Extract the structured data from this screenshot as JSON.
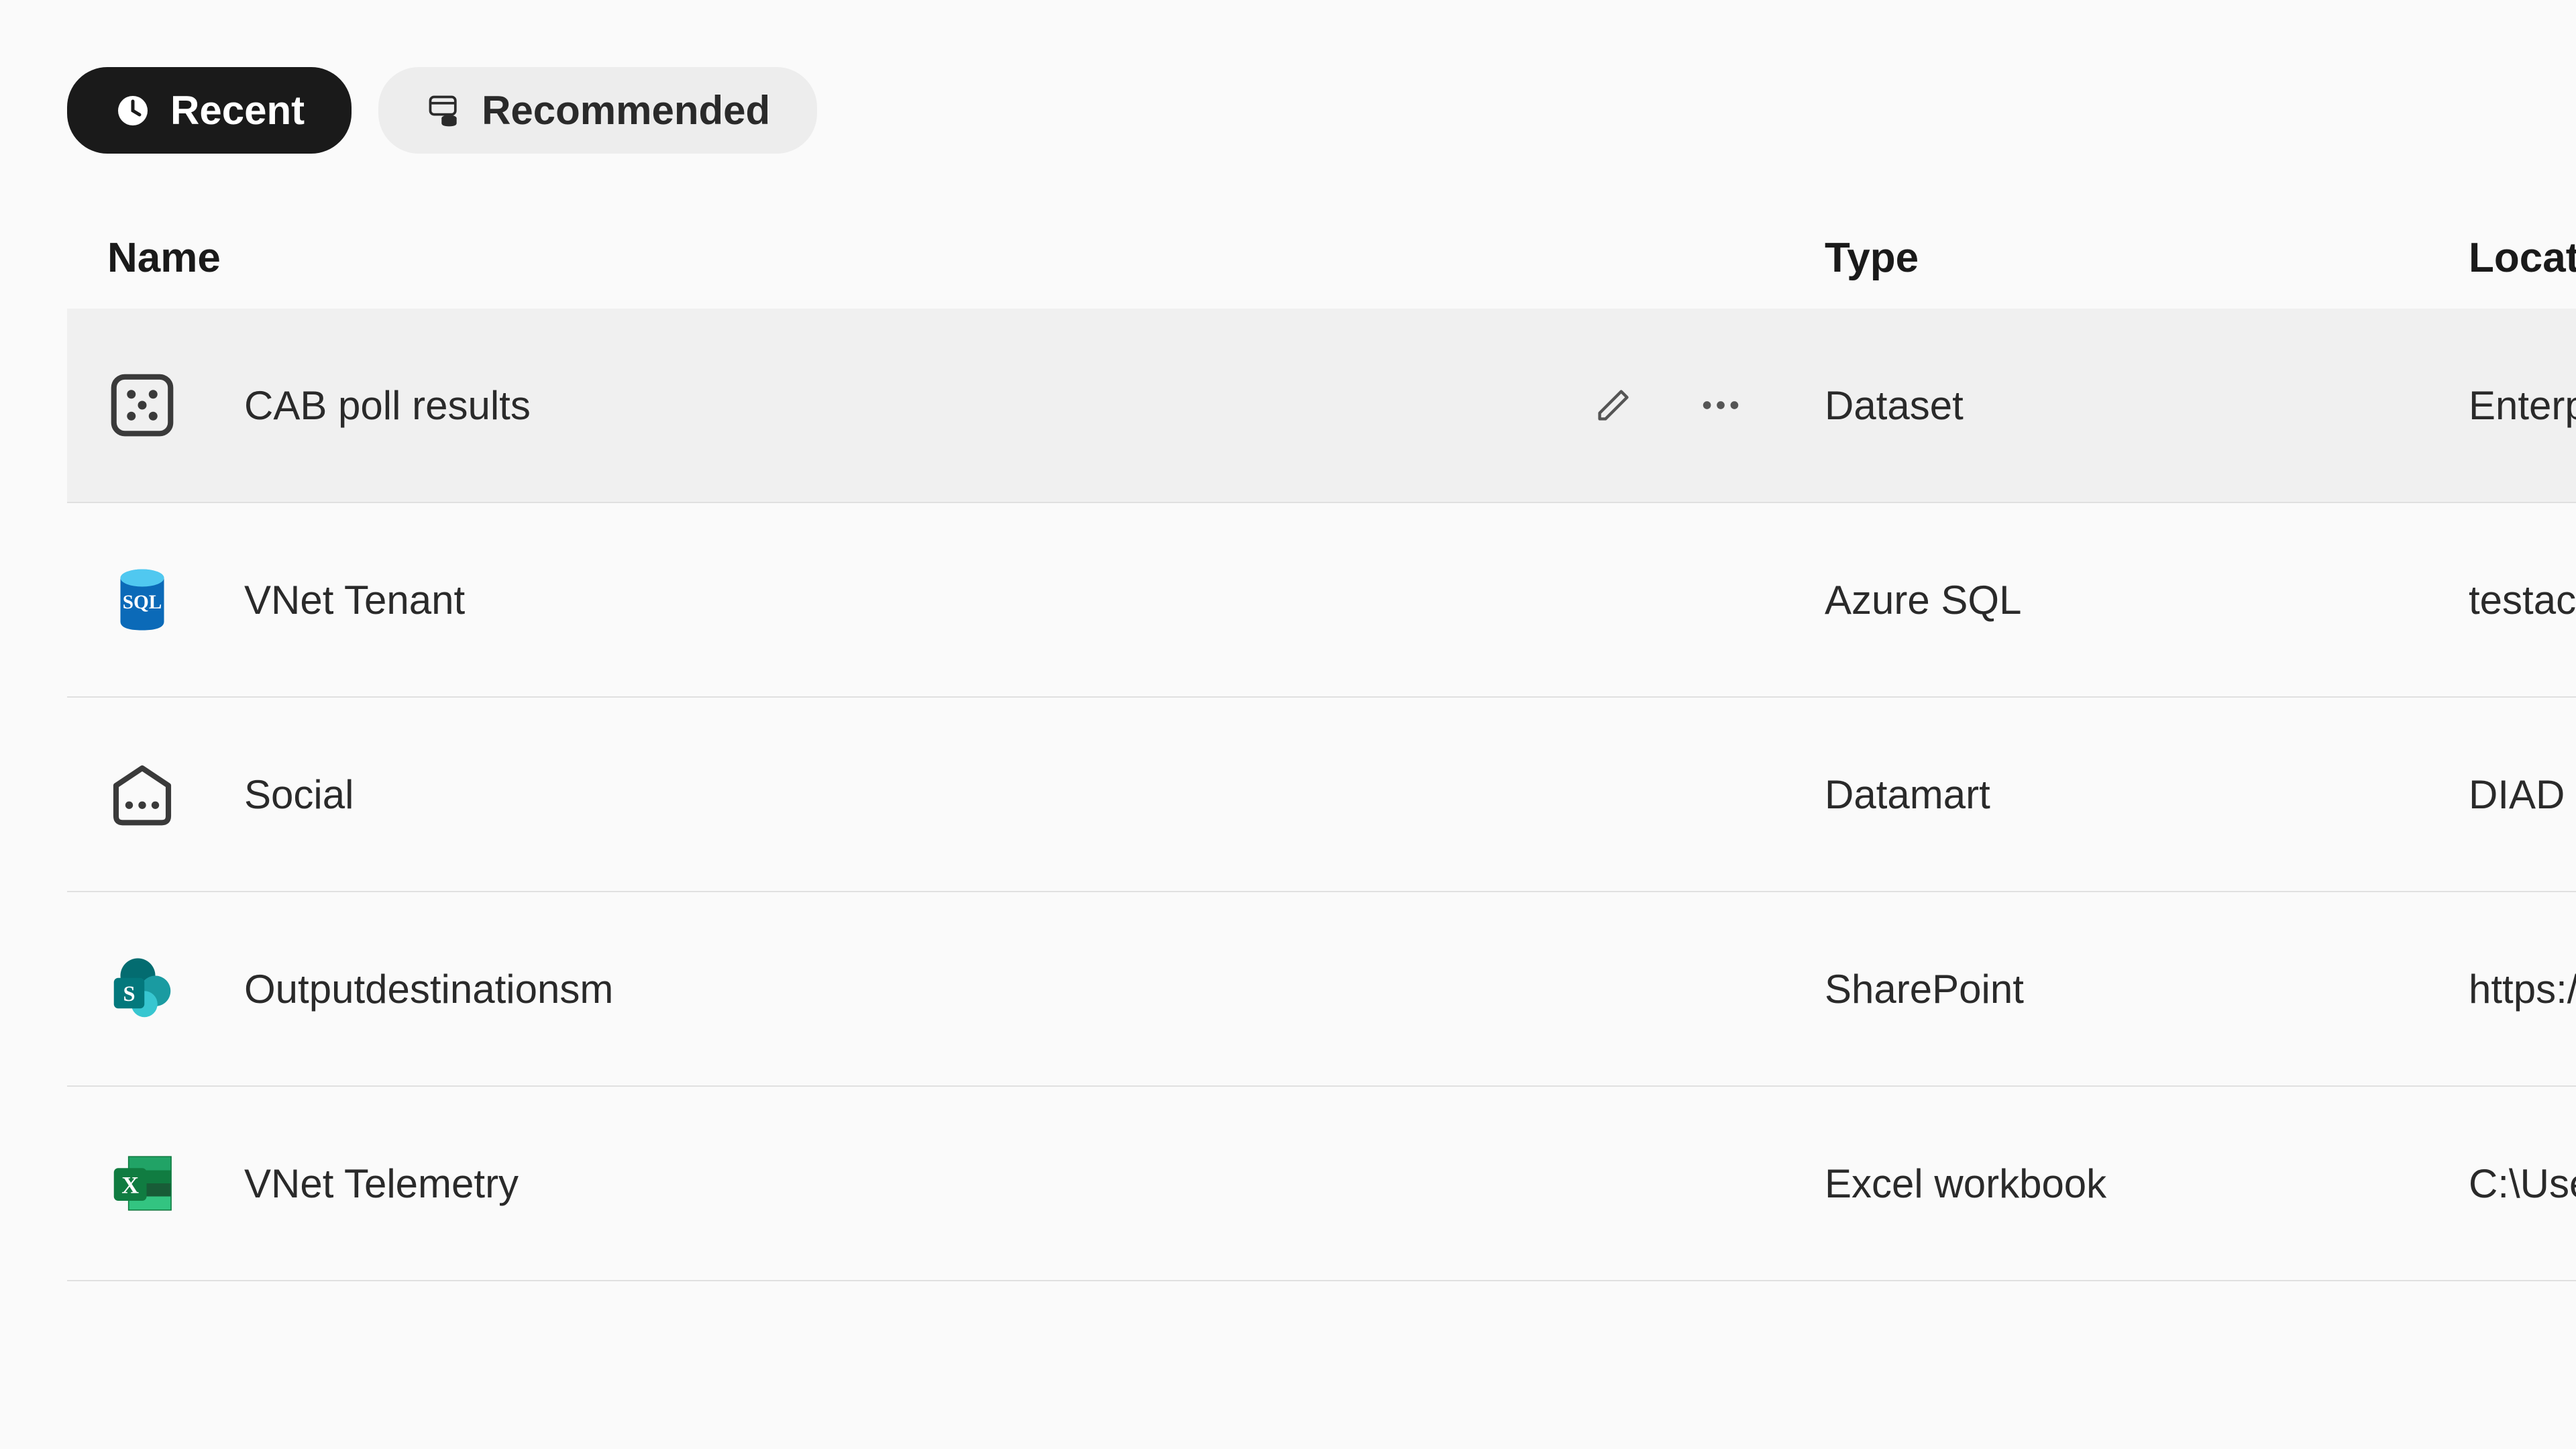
{
  "tabs": {
    "recent": "Recent",
    "recommended": "Recommended"
  },
  "columns": {
    "name": "Name",
    "type": "Type",
    "location": "Location"
  },
  "rows": [
    {
      "icon": "dataset",
      "name": "CAB poll results",
      "type": "Dataset",
      "location": "Enterprise",
      "hovered": true
    },
    {
      "icon": "sql",
      "name": "VNet Tenant",
      "type": "Azure SQL",
      "location": "testaccount",
      "hovered": false
    },
    {
      "icon": "datamart",
      "name": "Social",
      "type": "Datamart",
      "location": "DIAD",
      "hovered": false
    },
    {
      "icon": "sharepoint",
      "name": "Outputdestinationsm",
      "type": "SharePoint",
      "location": "https://",
      "hovered": false
    },
    {
      "icon": "excel",
      "name": "VNet Telemetry",
      "type": "Excel workbook",
      "location": "C:\\Users",
      "hovered": false
    }
  ]
}
